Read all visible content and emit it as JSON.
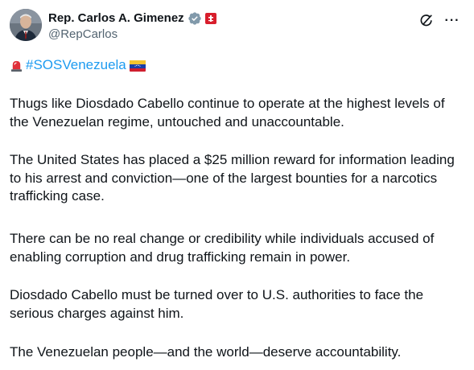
{
  "author": {
    "display_name": "Rep. Carlos A. Gimenez",
    "handle": "@RepCarlos",
    "verified_badge_icon": "verified-badge-icon",
    "affiliation_icon": "government-affiliation-icon",
    "colors": {
      "verified": "#829aab",
      "affiliation": "#d81e2c"
    }
  },
  "actions": {
    "grok_icon": "grok-icon",
    "more_label": "···"
  },
  "post": {
    "hashtag_line": {
      "siren_icon": "siren-emoji",
      "hashtag": "#SOSVenezuela",
      "flag_icon": "venezuela-flag-emoji"
    },
    "paragraphs": [
      "Thugs like Diosdado Cabello continue to operate at the highest levels of the Venezuelan regime, untouched and unaccountable.",
      "The United States has placed a $25 million reward for information leading to his arrest and conviction—one of the largest bounties for a narcotics trafficking case.",
      "There can be no real change or credibility while individuals accused of enabling corruption and drug trafficking remain in power.",
      "Diosdado Cabello must be turned over to U.S. authorities to face the serious charges against him.",
      "The Venezuelan people—and the world—deserve accountability."
    ],
    "colors": {
      "text": "#0f1419",
      "link": "#1d9bf0",
      "secondary": "#536471"
    }
  }
}
